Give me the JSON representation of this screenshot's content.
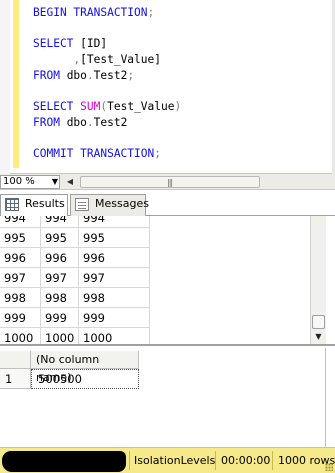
{
  "editor": {
    "lines": [
      [
        {
          "t": "BEGIN TRANSACTION",
          "c": "kw"
        },
        {
          "t": ";",
          "c": "gr"
        }
      ],
      [],
      [
        {
          "t": "SELECT ",
          "c": "kw"
        },
        {
          "t": "[ID]",
          "c": "tx"
        }
      ],
      [
        {
          "t": "      ,",
          "c": "gr"
        },
        {
          "t": "[Test_Value]",
          "c": "tx"
        }
      ],
      [
        {
          "t": "FROM ",
          "c": "kw"
        },
        {
          "t": "dbo",
          "c": "tx"
        },
        {
          "t": ".",
          "c": "gr"
        },
        {
          "t": "Test2",
          "c": "tx"
        },
        {
          "t": ";",
          "c": "gr"
        }
      ],
      [],
      [
        {
          "t": "SELECT ",
          "c": "kw"
        },
        {
          "t": "SUM",
          "c": "fn"
        },
        {
          "t": "(",
          "c": "gr"
        },
        {
          "t": "Test_Value",
          "c": "tx"
        },
        {
          "t": ")",
          "c": "gr"
        }
      ],
      [
        {
          "t": "FROM ",
          "c": "kw"
        },
        {
          "t": "dbo",
          "c": "tx"
        },
        {
          "t": ".",
          "c": "gr"
        },
        {
          "t": "Test2",
          "c": "tx"
        }
      ],
      [],
      [
        {
          "t": "COMMIT TRANSACTION",
          "c": "kw"
        },
        {
          "t": ";",
          "c": "gr"
        }
      ]
    ]
  },
  "zoom": {
    "value": "100 %"
  },
  "tabs": {
    "results": "Results",
    "messages": "Messages"
  },
  "grid1": {
    "rows": [
      [
        "994",
        "994",
        "994"
      ],
      [
        "995",
        "995",
        "995"
      ],
      [
        "996",
        "996",
        "996"
      ],
      [
        "997",
        "997",
        "997"
      ],
      [
        "998",
        "998",
        "998"
      ],
      [
        "999",
        "999",
        "999"
      ],
      [
        "1000",
        "1000",
        "1000"
      ]
    ]
  },
  "grid2": {
    "column": "(No column name)",
    "row_number": "1",
    "value": "500500"
  },
  "status": {
    "database": "IsolationLevels",
    "time": "00:00:00",
    "rows": "1000 rows"
  },
  "colors": {
    "keyword": "#1010f0",
    "function": "#e000e0",
    "statusbar": "#f5e98a"
  }
}
